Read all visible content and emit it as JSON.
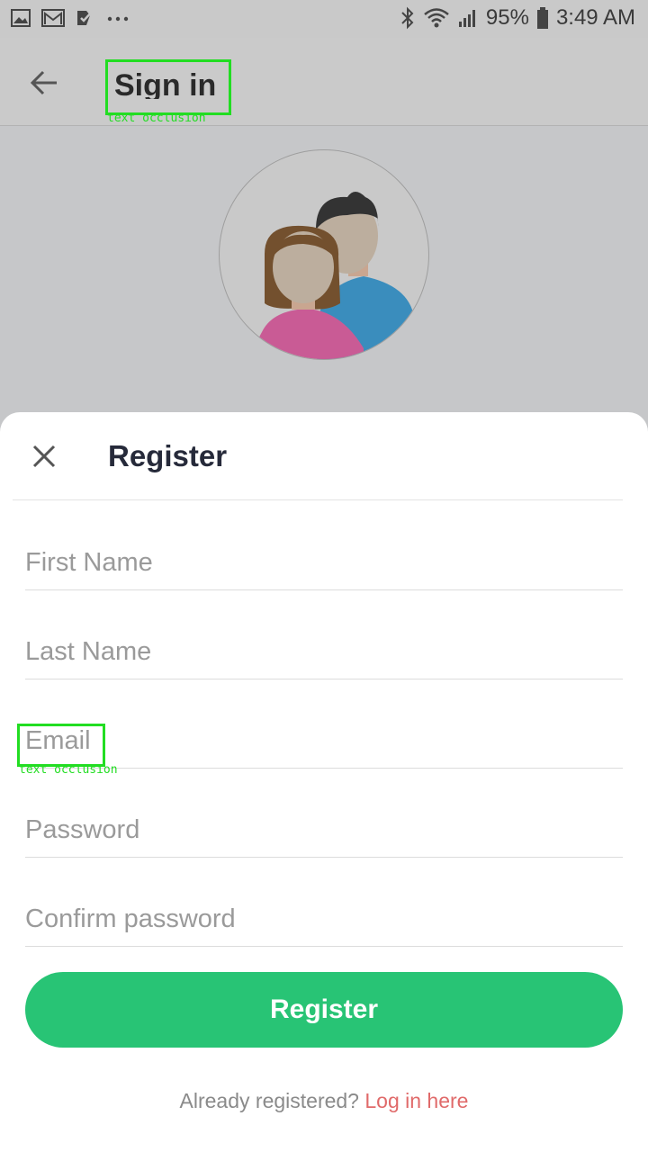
{
  "status_bar": {
    "battery": "95%",
    "time": "3:49 AM",
    "left_icons": [
      "photo-icon",
      "gmail-icon",
      "checklist-icon",
      "more-dots-icon"
    ],
    "right_icons": [
      "bluetooth-icon",
      "wifi-icon",
      "signal-icon",
      "battery-icon"
    ]
  },
  "app_bar": {
    "title": "Sign in",
    "back_icon": "arrow-left-icon"
  },
  "annotations": {
    "occlusion_label": "text occlusion"
  },
  "sheet": {
    "title": "Register",
    "close_icon": "close-icon",
    "fields": {
      "first_name": {
        "placeholder": "First Name",
        "value": ""
      },
      "last_name": {
        "placeholder": "Last Name",
        "value": ""
      },
      "email": {
        "placeholder": "Email",
        "value": ""
      },
      "password": {
        "placeholder": "Password",
        "value": ""
      },
      "confirm_password": {
        "placeholder": "Confirm password",
        "value": ""
      }
    },
    "register_button": "Register",
    "footer_text": "Already registered?",
    "footer_link": "Log in here"
  },
  "colors": {
    "accent": "#28c475",
    "link": "#e06a6a",
    "title": "#262a3a"
  }
}
